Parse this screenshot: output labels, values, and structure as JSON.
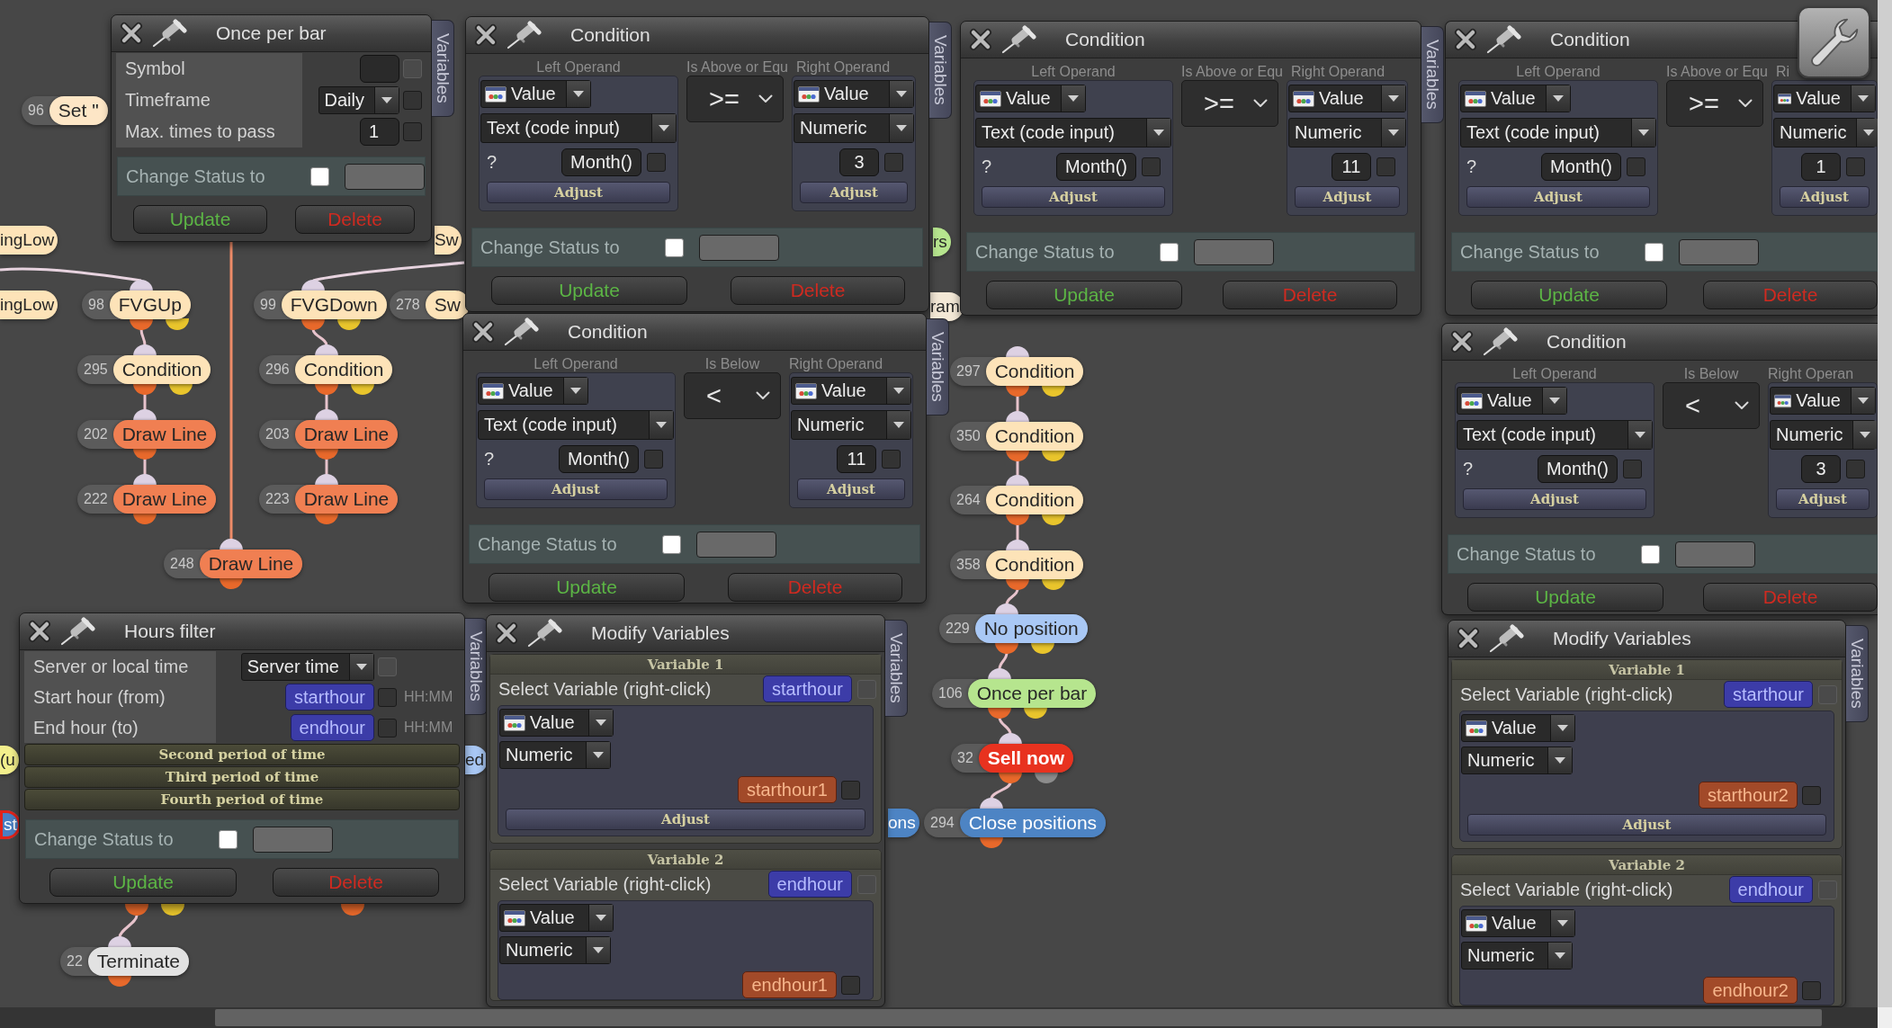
{
  "canvas": {
    "nodes": [
      {
        "number": "96",
        "label": "Set \"",
        "color": "#fde6c6",
        "kind": "fragment",
        "selected": false
      },
      {
        "label": "ingLow",
        "color": "#fde3b8",
        "kind": "fragment",
        "selected": false
      },
      {
        "label": "ingLow",
        "color": "#fde3b8",
        "kind": "fragment",
        "selected": false
      },
      {
        "number": "98",
        "label": "FVGUp",
        "color": "#fde3b8",
        "kind": "condition",
        "selected": false
      },
      {
        "number": "99",
        "label": "FVGDown",
        "color": "#fde3b8",
        "kind": "condition",
        "selected": false
      },
      {
        "number": "278",
        "label": "Sw",
        "color": "#fde3b8",
        "kind": "fragment",
        "selected": false
      },
      {
        "label": "Sw",
        "color": "#fde3b8",
        "kind": "fragment",
        "selected": false
      },
      {
        "number": "295",
        "label": "Condition",
        "color": "#fde3b8",
        "kind": "condition",
        "selected": false
      },
      {
        "number": "296",
        "label": "Condition",
        "color": "#fde3b8",
        "kind": "condition",
        "selected": false
      },
      {
        "number": "202",
        "label": "Draw Line",
        "color": "#f07f52",
        "kind": "action",
        "selected": false
      },
      {
        "number": "203",
        "label": "Draw Line",
        "color": "#f07f52",
        "kind": "action",
        "selected": false
      },
      {
        "number": "222",
        "label": "Draw Line",
        "color": "#f07f52",
        "kind": "action",
        "selected": false
      },
      {
        "number": "223",
        "label": "Draw Line",
        "color": "#f07f52",
        "kind": "action",
        "selected": false
      },
      {
        "number": "248",
        "label": "Draw Line",
        "color": "#f07f52",
        "kind": "action",
        "selected": false
      },
      {
        "label": "(u",
        "color": "#f3ef8c",
        "kind": "fragment",
        "selected": false
      },
      {
        "label": "st",
        "color": "#4a7fc2",
        "kind": "fragment",
        "selected": true
      },
      {
        "label": "ed",
        "color": "#a9c8f5",
        "kind": "fragment",
        "selected": false
      },
      {
        "label": "rs",
        "color": "#b6e58e",
        "kind": "fragment",
        "selected": false
      },
      {
        "label": "ram",
        "color": "#f3e8d6",
        "kind": "fragment",
        "selected": false
      },
      {
        "number": "297",
        "label": "Condition",
        "color": "#fde3b8",
        "kind": "condition",
        "selected": false
      },
      {
        "number": "350",
        "label": "Condition",
        "color": "#fde3b8",
        "kind": "condition",
        "selected": false
      },
      {
        "number": "264",
        "label": "Condition",
        "color": "#fde3b8",
        "kind": "condition",
        "selected": false
      },
      {
        "number": "358",
        "label": "Condition",
        "color": "#fde3b8",
        "kind": "condition",
        "selected": false
      },
      {
        "number": "229",
        "label": "No position",
        "color": "#a9c8f5",
        "kind": "condition",
        "selected": false
      },
      {
        "number": "106",
        "label": "Once per bar",
        "color": "#b6e58e",
        "kind": "condition",
        "selected": false
      },
      {
        "number": "32",
        "label": "Sell now",
        "color": "#e8321f",
        "kind": "trade",
        "selected": false
      },
      {
        "label": "ons",
        "color": "#4d84c4",
        "kind": "fragment",
        "selected": false
      },
      {
        "number": "294",
        "label": "Close positions",
        "color": "#4d84c4",
        "kind": "action",
        "selected": false
      },
      {
        "number": "22",
        "label": "Terminate",
        "color": "#e2e2e2",
        "kind": "action",
        "selected": false
      }
    ]
  },
  "panels": [
    {
      "kind": "settings",
      "title": "Once per bar",
      "side_tab": "Variables",
      "rows": [
        {
          "label": "Symbol",
          "kind": "field",
          "checkbox": {
            "checked": false,
            "disabled": true
          }
        },
        {
          "label": "Timeframe",
          "kind": "dropdown",
          "value": "Daily",
          "checkbox": {
            "checked": false,
            "disabled": false
          }
        },
        {
          "label": "Max. times to pass",
          "kind": "field",
          "value": "1",
          "checkbox": {
            "checked": false,
            "disabled": false
          }
        }
      ],
      "change_status": {
        "label": "Change Status to",
        "checked": false
      },
      "buttons": [
        {
          "label": "Update",
          "kind": "update"
        },
        {
          "label": "Delete",
          "kind": "delete"
        }
      ]
    },
    {
      "kind": "condition",
      "title": "Condition",
      "side_tab": "Variables",
      "left": {
        "heading": "Left Operand",
        "type": "Value",
        "format": "Text (code input)",
        "prefix": "?",
        "value": "Month()",
        "checkbox": {
          "checked": false,
          "disabled": false
        },
        "button": "Adjust"
      },
      "operator": {
        "heading": "Is Above or Equ",
        "symbol": ">="
      },
      "right": {
        "heading": "Right Operand",
        "type": "Value",
        "format": "Numeric",
        "value": "3",
        "checkbox": {
          "checked": false,
          "disabled": false
        },
        "button": "Adjust"
      },
      "change_status": {
        "label": "Change Status to",
        "checked": false
      },
      "buttons": [
        {
          "label": "Update",
          "kind": "update"
        },
        {
          "label": "Delete",
          "kind": "delete"
        }
      ]
    },
    {
      "kind": "condition",
      "title": "Condition",
      "side_tab": "Variables",
      "left": {
        "heading": "Left Operand",
        "type": "Value",
        "format": "Text (code input)",
        "prefix": "?",
        "value": "Month()",
        "checkbox": {
          "checked": false,
          "disabled": false
        },
        "button": "Adjust"
      },
      "operator": {
        "heading": "Is Above or Equ",
        "symbol": ">="
      },
      "right": {
        "heading": "Right Operand",
        "type": "Value",
        "format": "Numeric",
        "value": "11",
        "checkbox": {
          "checked": false,
          "disabled": false
        },
        "button": "Adjust"
      },
      "change_status": {
        "label": "Change Status to",
        "checked": false
      },
      "buttons": [
        {
          "label": "Update",
          "kind": "update"
        },
        {
          "label": "Delete",
          "kind": "delete"
        }
      ]
    },
    {
      "kind": "condition",
      "title": "Condition",
      "left": {
        "heading": "Left Operand",
        "type": "Value",
        "format": "Text (code input)",
        "prefix": "?",
        "value": "Month()",
        "checkbox": {
          "checked": false,
          "disabled": false
        },
        "button": "Adjust"
      },
      "operator": {
        "heading": "Is Above or Equ",
        "symbol": ">="
      },
      "right": {
        "heading": "Ri",
        "type": "Value",
        "format": "Numeric",
        "value": "1",
        "checkbox": {
          "checked": false,
          "disabled": false
        },
        "button": "Adjust"
      },
      "change_status": {
        "label": "Change Status to",
        "checked": false
      },
      "buttons": [
        {
          "label": "Update",
          "kind": "update"
        },
        {
          "label": "Delete",
          "kind": "delete"
        }
      ]
    },
    {
      "kind": "condition",
      "title": "Condition",
      "side_tab": "Variables",
      "left": {
        "heading": "Left Operand",
        "type": "Value",
        "format": "Text (code input)",
        "prefix": "?",
        "value": "Month()",
        "checkbox": {
          "checked": false,
          "disabled": false
        },
        "button": "Adjust"
      },
      "operator": {
        "heading": "Is Below",
        "symbol": "<"
      },
      "right": {
        "heading": "Right Operand",
        "type": "Value",
        "format": "Numeric",
        "value": "11",
        "checkbox": {
          "checked": false,
          "disabled": false
        },
        "button": "Adjust"
      },
      "change_status": {
        "label": "Change Status to",
        "checked": false
      },
      "buttons": [
        {
          "label": "Update",
          "kind": "update"
        },
        {
          "label": "Delete",
          "kind": "delete"
        }
      ]
    },
    {
      "kind": "condition",
      "title": "Condition",
      "left": {
        "heading": "Left Operand",
        "type": "Value",
        "format": "Text (code input)",
        "prefix": "?",
        "value": "Month()",
        "checkbox": {
          "checked": false,
          "disabled": false
        },
        "button": "Adjust"
      },
      "operator": {
        "heading": "Is Below",
        "symbol": "<"
      },
      "right": {
        "heading": "Right Operan",
        "type": "Value",
        "format": "Numeric",
        "value": "3",
        "checkbox": {
          "checked": false,
          "disabled": false
        },
        "button": "Adjust"
      },
      "change_status": {
        "label": "Change Status to",
        "checked": false
      },
      "buttons": [
        {
          "label": "Update",
          "kind": "update"
        },
        {
          "label": "Delete",
          "kind": "delete"
        }
      ]
    },
    {
      "kind": "hours_filter",
      "title": "Hours filter",
      "side_tab": "Variables",
      "rows": [
        {
          "label": "Server or local time",
          "kind": "dropdown",
          "value": "Server time",
          "checkbox": {
            "checked": false,
            "disabled": true
          }
        },
        {
          "label": "Start hour (from)",
          "kind": "chip",
          "value": "starthour",
          "checkbox": {
            "checked": false,
            "disabled": false
          },
          "hint": "HH:MM"
        },
        {
          "label": "End hour (to)",
          "kind": "chip",
          "value": "endhour",
          "checkbox": {
            "checked": false,
            "disabled": false
          },
          "hint": "HH:MM"
        }
      ],
      "sections": [
        "Second period of time",
        "Third period of time",
        "Fourth period of time"
      ],
      "change_status": {
        "label": "Change Status to",
        "checked": false
      },
      "buttons": [
        {
          "label": "Update",
          "kind": "update"
        },
        {
          "label": "Delete",
          "kind": "delete"
        }
      ]
    },
    {
      "kind": "modify_variables",
      "title": "Modify Variables",
      "side_tab": "Variables",
      "variables": [
        {
          "heading": "Variable 1",
          "select_label": "Select Variable (right-click)",
          "variable": "starthour",
          "variable_checkbox": {
            "checked": false,
            "disabled": true
          },
          "type": "Value",
          "format": "Numeric",
          "value": "starthour1",
          "checkbox": {
            "checked": false,
            "disabled": false
          },
          "button": "Adjust"
        },
        {
          "heading": "Variable 2",
          "select_label": "Select Variable (right-click)",
          "variable": "endhour",
          "variable_checkbox": {
            "checked": false,
            "disabled": true
          },
          "type": "Value",
          "format": "Numeric",
          "value": "endhour1",
          "checkbox": {
            "checked": false,
            "disabled": false
          }
        }
      ]
    },
    {
      "kind": "modify_variables",
      "title": "Modify Variables",
      "side_tab": "Variables",
      "variables": [
        {
          "heading": "Variable 1",
          "select_label": "Select Variable (right-click)",
          "variable": "starthour",
          "variable_checkbox": {
            "checked": false,
            "disabled": true
          },
          "type": "Value",
          "format": "Numeric",
          "value": "starthour2",
          "checkbox": {
            "checked": false,
            "disabled": false
          },
          "button": "Adjust"
        },
        {
          "heading": "Variable 2",
          "select_label": "Select Variable (right-click)",
          "variable": "endhour",
          "variable_checkbox": {
            "checked": false,
            "disabled": true
          },
          "type": "Value",
          "format": "Numeric",
          "value": "endhour2",
          "checkbox": {
            "checked": false,
            "disabled": false
          }
        }
      ]
    }
  ]
}
